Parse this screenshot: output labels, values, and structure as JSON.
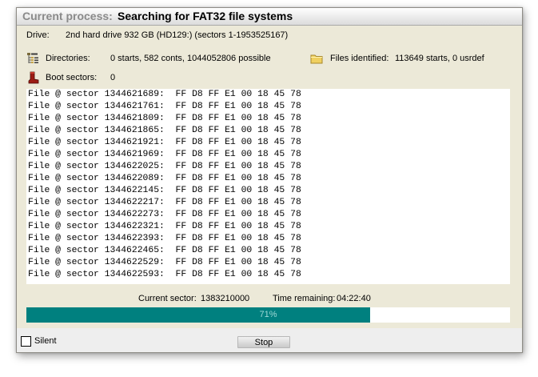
{
  "title": {
    "prefix": "Current process:",
    "text": "Searching for FAT32 file systems"
  },
  "drive": {
    "label": "Drive:",
    "value": "2nd hard drive 932 GB (HD129:) (sectors 1-1953525167)"
  },
  "directories": {
    "icon": "directory-tree-icon",
    "label": "Directories:",
    "value": "0 starts, 582 conts, 1044052806 possible"
  },
  "files_identified": {
    "icon": "folder-icon",
    "label": "Files identified:",
    "value": "113649 starts, 0 usrdef"
  },
  "boot_sectors": {
    "icon": "boot-icon",
    "label": "Boot sectors:",
    "value": "0"
  },
  "log": [
    "File @ sector 1344621689:  FF D8 FF E1 00 18 45 78",
    "File @ sector 1344621761:  FF D8 FF E1 00 18 45 78",
    "File @ sector 1344621809:  FF D8 FF E1 00 18 45 78",
    "File @ sector 1344621865:  FF D8 FF E1 00 18 45 78",
    "File @ sector 1344621921:  FF D8 FF E1 00 18 45 78",
    "File @ sector 1344621969:  FF D8 FF E1 00 18 45 78",
    "File @ sector 1344622025:  FF D8 FF E1 00 18 45 78",
    "File @ sector 1344622089:  FF D8 FF E1 00 18 45 78",
    "File @ sector 1344622145:  FF D8 FF E1 00 18 45 78",
    "File @ sector 1344622217:  FF D8 FF E1 00 18 45 78",
    "File @ sector 1344622273:  FF D8 FF E1 00 18 45 78",
    "File @ sector 1344622321:  FF D8 FF E1 00 18 45 78",
    "File @ sector 1344622393:  FF D8 FF E1 00 18 45 78",
    "File @ sector 1344622465:  FF D8 FF E1 00 18 45 78",
    "File @ sector 1344622529:  FF D8 FF E1 00 18 45 78",
    "File @ sector 1344622593:  FF D8 FF E1 00 18 45 78"
  ],
  "status": {
    "current_sector_label": "Current sector:",
    "current_sector_value": "1383210000",
    "time_remaining_label": "Time remaining:",
    "time_remaining_value": "04:22:40"
  },
  "progress": {
    "percent": 71,
    "text": "71%",
    "fill_color": "#00807f"
  },
  "silent": {
    "label": "Silent",
    "checked": false
  },
  "stop_button": {
    "label": "Stop"
  }
}
